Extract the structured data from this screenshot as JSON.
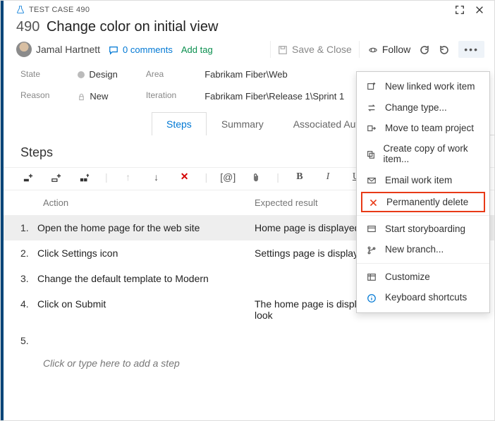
{
  "window": {
    "type_label": "TEST CASE 490",
    "id": "490",
    "title": "Change color on initial view"
  },
  "user": {
    "name": "Jamal Hartnett"
  },
  "comments": {
    "count_label": "0 comments"
  },
  "addtag_label": "Add tag",
  "save_label": "Save & Close",
  "follow_label": "Follow",
  "fields": {
    "state_label": "State",
    "state_value": "Design",
    "reason_label": "Reason",
    "reason_value": "New",
    "area_label": "Area",
    "area_value": "Fabrikam Fiber\\Web",
    "iteration_label": "Iteration",
    "iteration_value": "Fabrikam Fiber\\Release 1\\Sprint 1"
  },
  "tabs": {
    "steps": "Steps",
    "summary": "Summary",
    "auto": "Associated Automation"
  },
  "section_title": "Steps",
  "grid": {
    "action_header": "Action",
    "expected_header": "Expected result",
    "rows": [
      {
        "n": "1.",
        "action": "Open the home page for the web site",
        "expected": "Home page is displayed"
      },
      {
        "n": "2.",
        "action": "Click Settings icon",
        "expected": "Settings page is displayed"
      },
      {
        "n": "3.",
        "action": "Change the default template to Modern",
        "expected": ""
      },
      {
        "n": "4.",
        "action": "Click on Submit",
        "expected": "The home page is displayed with the Modern look"
      },
      {
        "n": "5.",
        "action": "",
        "expected": ""
      }
    ],
    "placeholder": "Click or type here to add a step"
  },
  "menu": {
    "new_linked": "New linked work item",
    "change_type": "Change type...",
    "move_team": "Move to team project",
    "copy": "Create copy of work item...",
    "email": "Email work item",
    "delete": "Permanently delete",
    "storyboard": "Start storyboarding",
    "new_branch": "New branch...",
    "customize": "Customize",
    "shortcuts": "Keyboard shortcuts"
  }
}
